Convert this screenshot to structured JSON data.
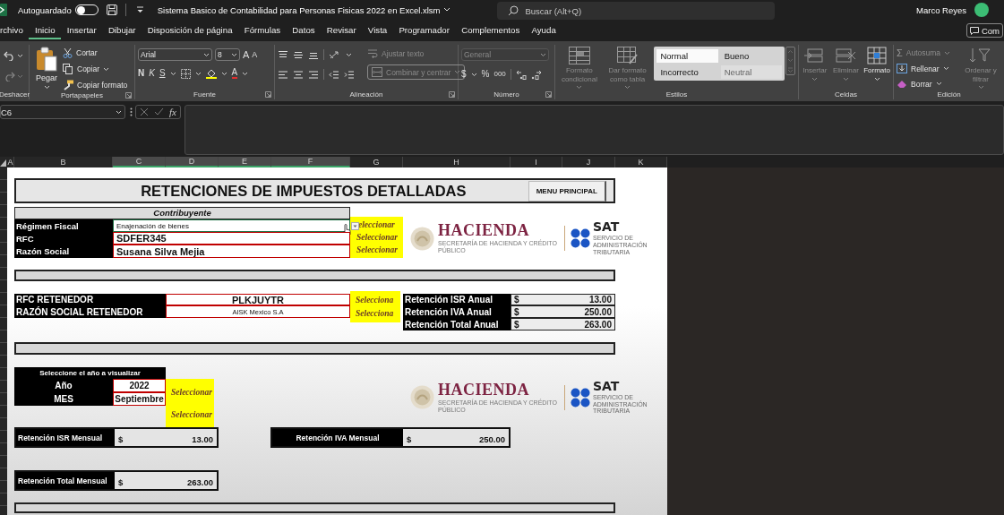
{
  "title_bar": {
    "autosave_label": "Autoguardado",
    "autosave_on": false,
    "document_title": "Sistema Basico de Contabilidad para Personas Fisicas 2022 en Excel.xlsm",
    "search_placeholder": "Buscar (Alt+Q)",
    "user_name": "Marco Reyes"
  },
  "menu_tabs": [
    {
      "label": "rchivo",
      "selected": false
    },
    {
      "label": "Inicio",
      "selected": true
    },
    {
      "label": "Insertar",
      "selected": false
    },
    {
      "label": "Dibujar",
      "selected": false
    },
    {
      "label": "Disposición de página",
      "selected": false
    },
    {
      "label": "Fórmulas",
      "selected": false
    },
    {
      "label": "Datos",
      "selected": false
    },
    {
      "label": "Revisar",
      "selected": false
    },
    {
      "label": "Vista",
      "selected": false
    },
    {
      "label": "Programador",
      "selected": false
    },
    {
      "label": "Complementos",
      "selected": false
    },
    {
      "label": "Ayuda",
      "selected": false
    }
  ],
  "comment_button": "Com",
  "ribbon": {
    "undo": {
      "group_label": "Deshacer"
    },
    "clipboard": {
      "paste": "Pegar",
      "cut": "Cortar",
      "copy": "Copiar",
      "format_painter": "Copiar formato",
      "group_label": "Portapapeles"
    },
    "font": {
      "font_name": "Arial",
      "font_size": "8",
      "grow": "A",
      "shrink": "A",
      "bold": "N",
      "italic": "K",
      "underline": "S",
      "font_color": "A",
      "group_label": "Fuente"
    },
    "alignment": {
      "wrap_text": {
        "label": "Ajustar texto",
        "disabled": true
      },
      "merge": {
        "label": "Combinar y centrar",
        "disabled": true
      },
      "group_label": "Alineación"
    },
    "number": {
      "format": {
        "value": "General",
        "disabled": true
      },
      "currency": "$",
      "percent": "%",
      "thousands": "000",
      "group_label": "Número"
    },
    "styles": {
      "conditional": {
        "label": "Formato condicional",
        "disabled": true
      },
      "as_table": {
        "label": "Dar formato como tabla",
        "disabled": true
      },
      "gallery": [
        {
          "label": "Normal",
          "selected": true
        },
        {
          "label": "Bueno",
          "selected": false
        },
        {
          "label": "Incorrecto",
          "selected": false
        },
        {
          "label": "Neutral",
          "selected": false
        }
      ],
      "group_label": "Estilos"
    },
    "cells": {
      "buttons": [
        {
          "label": "Insertar",
          "disabled": true
        },
        {
          "label": "Eliminar",
          "disabled": true
        },
        {
          "label": "Formato",
          "disabled": false
        }
      ],
      "group_label": "Celdas"
    },
    "editing": {
      "autosum": {
        "symbol": "Σ",
        "label": "Autosuma",
        "disabled": true
      },
      "fill": {
        "label": "Rellenar",
        "disabled": false
      },
      "clear": {
        "label": "Borrar",
        "disabled": false
      },
      "sort": {
        "label": "Ordenar y filtrar",
        "disabled": true
      },
      "group_label": "Edición"
    }
  },
  "formula_bar": {
    "name_box": "C6",
    "function_label": "fx"
  },
  "columns": [
    {
      "label": "A",
      "selected": false
    },
    {
      "label": "B",
      "selected": false
    },
    {
      "label": "C",
      "selected": true
    },
    {
      "label": "D",
      "selected": true
    },
    {
      "label": "E",
      "selected": true
    },
    {
      "label": "F",
      "selected": true
    },
    {
      "label": "G",
      "selected": false
    },
    {
      "label": "H",
      "selected": false
    },
    {
      "label": "I",
      "selected": false
    },
    {
      "label": "J",
      "selected": false
    },
    {
      "label": "K",
      "selected": false
    }
  ],
  "sheet": {
    "title": "RETENCIONES DE IMPUESTOS DETALLADAS",
    "menu_button": "MENU PRINCIPAL",
    "taxpayer": {
      "heading": "Contribuyente",
      "rows": [
        {
          "label": "Régimen Fiscal",
          "value": "Enajenación de bienes",
          "kind": "plain",
          "active": true,
          "link": "eleccionar"
        },
        {
          "label": "RFC",
          "value": "SDFER345",
          "kind": "bold",
          "active": false,
          "link": "Seleccionar"
        },
        {
          "label": "Razón Social",
          "value": "Susana Silva Mejia",
          "kind": "bold",
          "active": false,
          "link": "Seleccionar"
        }
      ]
    },
    "logos": [
      {
        "agency": "HACIENDA",
        "agency_subtitle": "SECRETARÍA DE HACIENDA Y CRÉDITO PÚBLICO",
        "brand": "SAT",
        "brand_subtitle": "SERVICIO DE ADMINISTRACIÓN TRIBUTARIA"
      },
      {
        "agency": "HACIENDA",
        "agency_subtitle": "SECRETARÍA DE HACIENDA Y CRÉDITO PÚBLICO",
        "brand": "SAT",
        "brand_subtitle": "SERVICIO DE ADMINISTRACIÓN TRIBUTARIA"
      }
    ],
    "withholder": {
      "rows": [
        {
          "label": "RFC RETENEDOR",
          "value": "PLKJUYTR",
          "kind": "bold",
          "link": "Selecciona"
        },
        {
          "label": "RAZÓN SOCIAL RETENEDOR",
          "value": "AISK Mexico S.A",
          "kind": "plain",
          "link": "Selecciona"
        }
      ]
    },
    "annual": [
      {
        "label": "Retención ISR Anual",
        "currency": "$",
        "amount": "13.00"
      },
      {
        "label": "Retención IVA Anual",
        "currency": "$",
        "amount": "250.00"
      },
      {
        "label": "Retención Total Anual",
        "currency": "$",
        "amount": "263.00"
      }
    ],
    "period": {
      "heading": "Seleccione el año a visualizar",
      "rows": [
        {
          "label": "Año",
          "value": "2022",
          "link": "Seleccionar"
        },
        {
          "label": "MES",
          "value": "Septiembre",
          "link": "Seleccionar"
        }
      ]
    },
    "monthly": [
      {
        "label": "Retención ISR Mensual",
        "currency": "$",
        "amount": "13.00"
      },
      {
        "label": "Retención IVA Mensual",
        "currency": "$",
        "amount": "250.00"
      },
      {
        "label": "Retención Total Mensual",
        "currency": "$",
        "amount": "263.00"
      }
    ]
  }
}
